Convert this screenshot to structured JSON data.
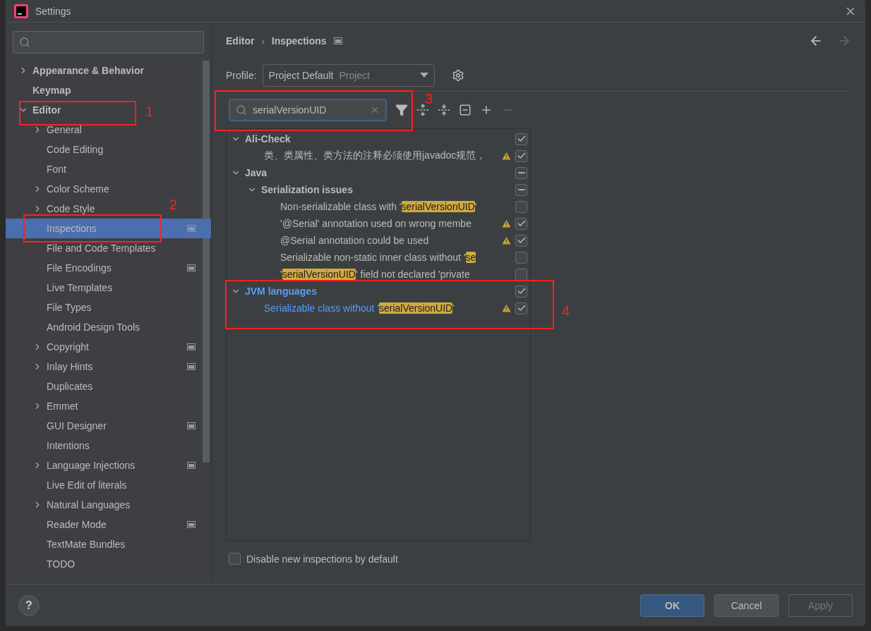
{
  "window": {
    "title": "Settings"
  },
  "sidebar": {
    "items": [
      {
        "label": "Appearance & Behavior",
        "expanded": false,
        "selected": false
      },
      {
        "label": "Keymap",
        "selected": false
      },
      {
        "label": "Editor",
        "expanded": true,
        "selected": false,
        "callout": "1",
        "children": [
          {
            "label": "General",
            "expanded": false,
            "selected": false
          },
          {
            "label": "Code Editing",
            "selected": false
          },
          {
            "label": "Font",
            "selected": false
          },
          {
            "label": "Color Scheme",
            "expanded": false,
            "selected": false
          },
          {
            "label": "Code Style",
            "expanded": false,
            "selected": false
          },
          {
            "label": "Inspections",
            "selected": true,
            "project_scope": true,
            "callout": "2"
          },
          {
            "label": "File and Code Templates",
            "selected": false
          },
          {
            "label": "File Encodings",
            "selected": false,
            "project_scope": true
          },
          {
            "label": "Live Templates",
            "selected": false
          },
          {
            "label": "File Types",
            "selected": false
          },
          {
            "label": "Android Design Tools",
            "selected": false
          },
          {
            "label": "Copyright",
            "expanded": false,
            "selected": false,
            "project_scope": true
          },
          {
            "label": "Inlay Hints",
            "expanded": false,
            "selected": false,
            "project_scope": true
          },
          {
            "label": "Duplicates",
            "selected": false
          },
          {
            "label": "Emmet",
            "expanded": false,
            "selected": false
          },
          {
            "label": "GUI Designer",
            "selected": false,
            "project_scope": true
          },
          {
            "label": "Intentions",
            "selected": false
          },
          {
            "label": "Language Injections",
            "expanded": false,
            "selected": false,
            "project_scope": true
          },
          {
            "label": "Live Edit of literals",
            "selected": false
          },
          {
            "label": "Natural Languages",
            "expanded": false,
            "selected": false
          },
          {
            "label": "Reader Mode",
            "selected": false,
            "project_scope": true
          },
          {
            "label": "TextMate Bundles",
            "selected": false
          },
          {
            "label": "TODO",
            "selected": false
          }
        ]
      }
    ]
  },
  "breadcrumb": {
    "items": [
      "Editor",
      "Inspections"
    ],
    "separator": "›"
  },
  "profile": {
    "label": "Profile:",
    "value": "Project Default",
    "scope": "Project"
  },
  "filter": {
    "value": "serialVersionUID",
    "callout": "3"
  },
  "tree": [
    {
      "kind": "group",
      "label": [
        {
          "text": "Ali-Check",
          "match": false
        }
      ],
      "expanded": true,
      "checked": true,
      "mixed": false,
      "modified": false,
      "children": [
        {
          "kind": "item",
          "label": [
            {
              "text": "类、类属性、类方法的注释必须使用javadoc规范，",
              "match": false
            }
          ],
          "warning": true,
          "checked": true,
          "mixed": false,
          "modified": false
        }
      ]
    },
    {
      "kind": "group",
      "label": [
        {
          "text": "Java",
          "match": false
        }
      ],
      "expanded": true,
      "mixed": true,
      "modified": false,
      "children": [
        {
          "kind": "group",
          "label": [
            {
              "text": "Serialization issues",
              "match": false
            }
          ],
          "expanded": true,
          "mixed": true,
          "modified": false,
          "children": [
            {
              "kind": "item",
              "label": [
                {
                  "text": "Non-serializable class with '",
                  "match": false
                },
                {
                  "text": "serialVersionUID",
                  "match": true
                },
                {
                  "text": "'",
                  "match": false
                }
              ],
              "warning": false,
              "checked": false,
              "mixed": false,
              "modified": false
            },
            {
              "kind": "item",
              "label": [
                {
                  "text": "'@Serial' annotation used on wrong membe",
                  "match": false
                }
              ],
              "warning": true,
              "checked": true,
              "mixed": false,
              "modified": false
            },
            {
              "kind": "item",
              "label": [
                {
                  "text": "@Serial annotation could be used",
                  "match": false
                }
              ],
              "warning": true,
              "checked": true,
              "mixed": false,
              "modified": false
            },
            {
              "kind": "item",
              "label": [
                {
                  "text": "Serializable non-static inner class without '",
                  "match": false
                },
                {
                  "text": "se",
                  "match": true
                }
              ],
              "warning": false,
              "checked": false,
              "mixed": false,
              "modified": false
            },
            {
              "kind": "item",
              "label": [
                {
                  "text": "'",
                  "match": false
                },
                {
                  "text": "serialVersionUID",
                  "match": true
                },
                {
                  "text": "' field not declared 'private",
                  "match": false
                }
              ],
              "warning": false,
              "checked": false,
              "mixed": false,
              "modified": false
            }
          ]
        }
      ]
    },
    {
      "kind": "group",
      "label": [
        {
          "text": "JVM languages",
          "match": false
        }
      ],
      "expanded": true,
      "checked": true,
      "mixed": false,
      "modified": true,
      "callout": "4",
      "children": [
        {
          "kind": "item",
          "label": [
            {
              "text": "Serializable class without '",
              "match": false
            },
            {
              "text": "serialVersionUID",
              "match": true
            },
            {
              "text": "'",
              "match": false
            }
          ],
          "warning": true,
          "checked": true,
          "mixed": false,
          "modified": true
        }
      ]
    }
  ],
  "disable_new": {
    "label": "Disable new inspections by default",
    "checked": false
  },
  "help": {
    "label": "?"
  },
  "buttons": [
    {
      "label": "OK",
      "kind": "primary"
    },
    {
      "label": "Cancel",
      "kind": "normal"
    },
    {
      "label": "Apply",
      "kind": "disabled"
    }
  ]
}
